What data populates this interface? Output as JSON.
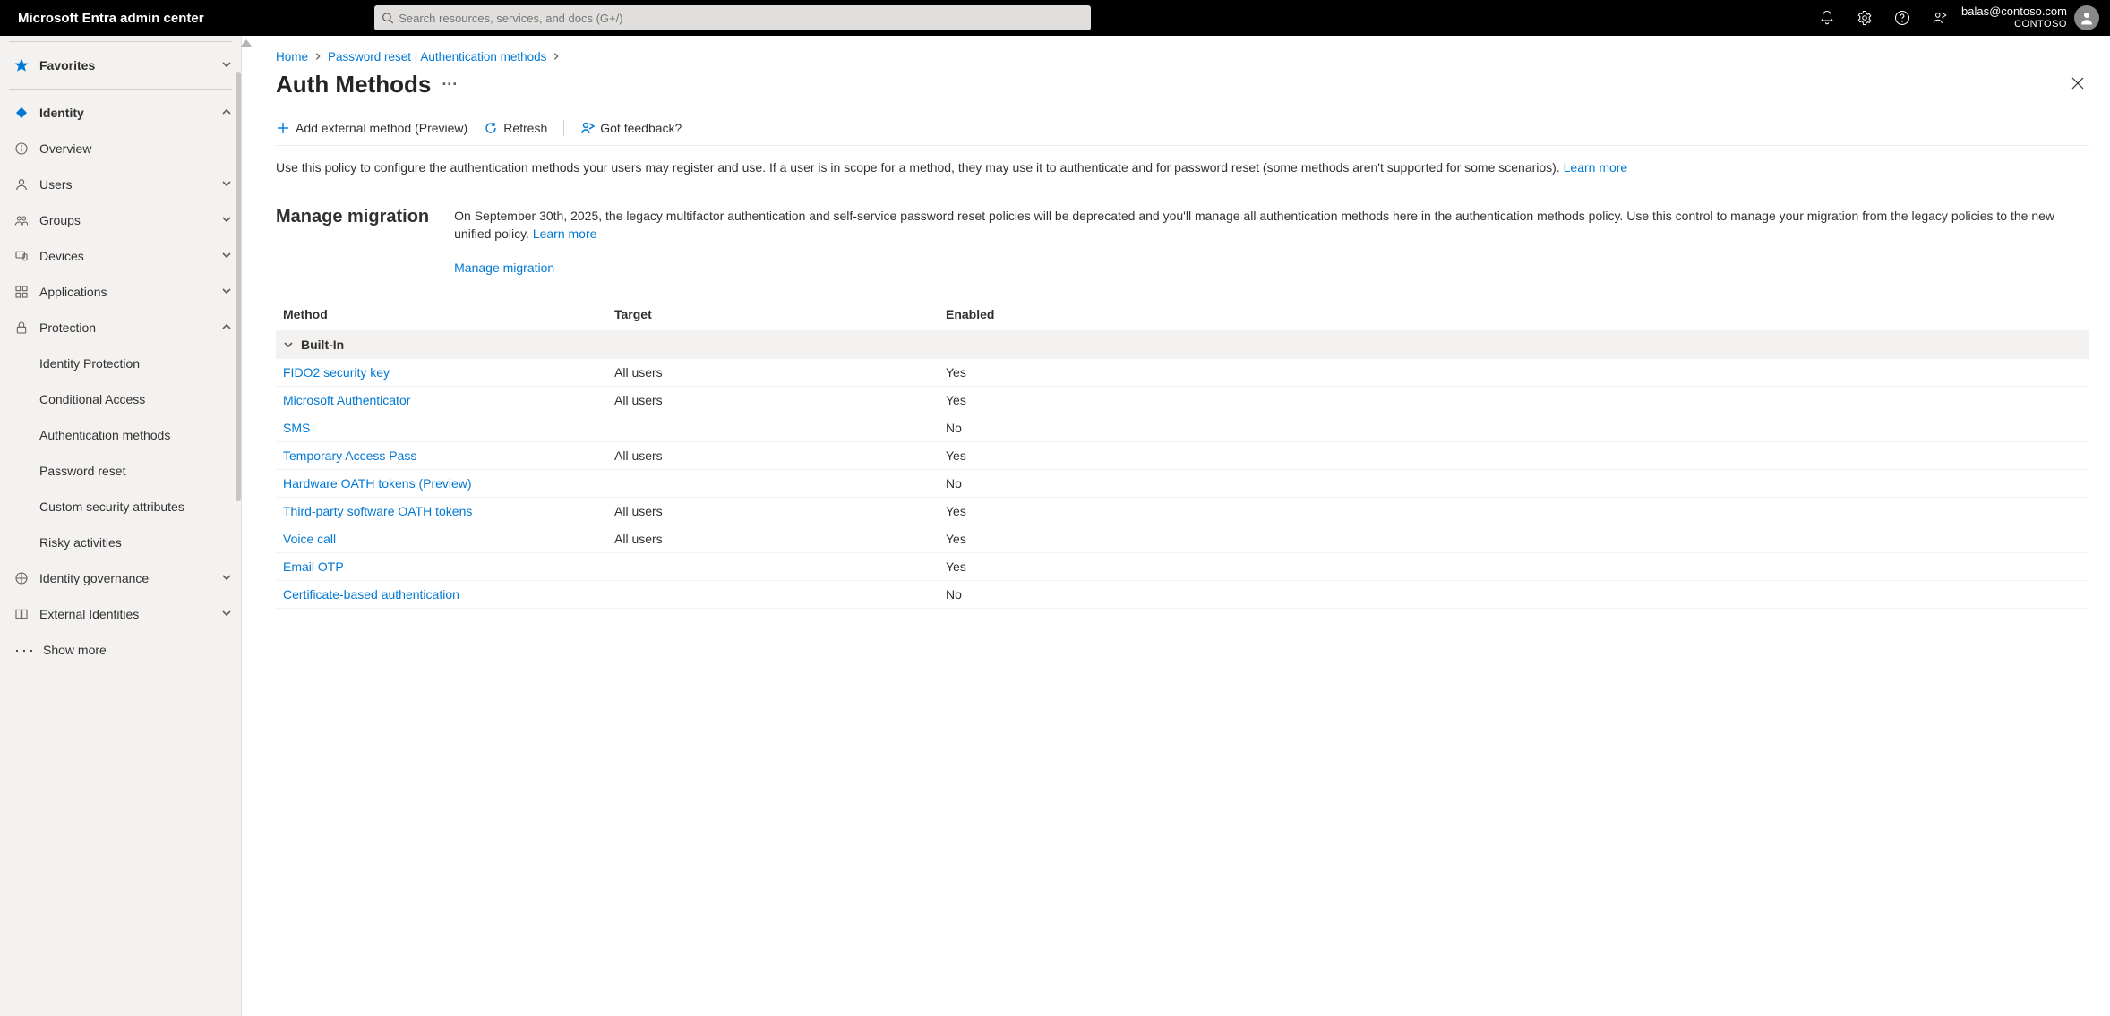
{
  "topbar": {
    "title": "Microsoft Entra admin center",
    "search_placeholder": "Search resources, services, and docs (G+/)",
    "account_email": "balas@contoso.com",
    "account_tenant": "CONTOSO"
  },
  "sidebar": {
    "favorites": "Favorites",
    "identity": "Identity",
    "identity_items": {
      "overview": "Overview",
      "users": "Users",
      "groups": "Groups",
      "devices": "Devices",
      "applications": "Applications",
      "protection": "Protection"
    },
    "protection_items": {
      "identity_protection": "Identity Protection",
      "conditional_access": "Conditional Access",
      "auth_methods": "Authentication methods",
      "password_reset": "Password reset",
      "custom_sec_attrs": "Custom security attributes",
      "risky_activities": "Risky activities"
    },
    "identity_governance": "Identity governance",
    "external_identities": "External Identities",
    "show_more": "Show more"
  },
  "breadcrumb": {
    "home": "Home",
    "parent": "Password reset | Authentication methods"
  },
  "page": {
    "title": "Auth Methods"
  },
  "cmdbar": {
    "add": "Add external method (Preview)",
    "refresh": "Refresh",
    "feedback": "Got feedback?"
  },
  "intro": {
    "text": "Use this policy to configure the authentication methods your users may register and use. If a user is in scope for a method, they may use it to authenticate and for password reset (some methods aren't supported for some scenarios). ",
    "learn_more": "Learn more"
  },
  "migration": {
    "heading": "Manage migration",
    "body": "On September 30th, 2025, the legacy multifactor authentication and self-service password reset policies will be deprecated and you'll manage all authentication methods here in the authentication methods policy. Use this control to manage your migration from the legacy policies to the new unified policy. ",
    "learn_more": "Learn more",
    "link": "Manage migration"
  },
  "table": {
    "columns": {
      "method": "Method",
      "target": "Target",
      "enabled": "Enabled"
    },
    "group_label": "Built-In",
    "rows": [
      {
        "method": "FIDO2 security key",
        "target": "All users",
        "enabled": "Yes"
      },
      {
        "method": "Microsoft Authenticator",
        "target": "All users",
        "enabled": "Yes"
      },
      {
        "method": "SMS",
        "target": "",
        "enabled": "No"
      },
      {
        "method": "Temporary Access Pass",
        "target": "All users",
        "enabled": "Yes"
      },
      {
        "method": "Hardware OATH tokens (Preview)",
        "target": "",
        "enabled": "No"
      },
      {
        "method": "Third-party software OATH tokens",
        "target": "All users",
        "enabled": "Yes"
      },
      {
        "method": "Voice call",
        "target": "All users",
        "enabled": "Yes"
      },
      {
        "method": "Email OTP",
        "target": "",
        "enabled": "Yes"
      },
      {
        "method": "Certificate-based authentication",
        "target": "",
        "enabled": "No"
      }
    ]
  }
}
